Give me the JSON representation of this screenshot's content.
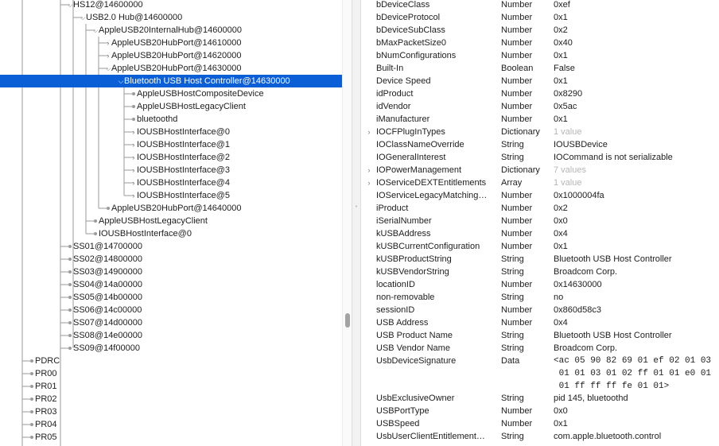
{
  "tree": [
    {
      "label": "HS12@14600000",
      "depth": 3,
      "disclosure": "open"
    },
    {
      "label": "USB2.0 Hub@14600000",
      "depth": 4,
      "disclosure": "open"
    },
    {
      "label": "AppleUSB20InternalHub@14600000",
      "depth": 5,
      "disclosure": "open"
    },
    {
      "label": "AppleUSB20HubPort@14610000",
      "depth": 6,
      "disclosure": "closed"
    },
    {
      "label": "AppleUSB20HubPort@14620000",
      "depth": 6,
      "disclosure": "closed"
    },
    {
      "label": "AppleUSB20HubPort@14630000",
      "depth": 6,
      "disclosure": "open"
    },
    {
      "label": "Bluetooth USB Host Controller@14630000",
      "depth": 7,
      "disclosure": "open",
      "selected": true
    },
    {
      "label": "AppleUSBHostCompositeDevice",
      "depth": 8,
      "disclosure": "leaf"
    },
    {
      "label": "AppleUSBHostLegacyClient",
      "depth": 8,
      "disclosure": "leaf"
    },
    {
      "label": "bluetoothd",
      "depth": 8,
      "disclosure": "leaf"
    },
    {
      "label": "IOUSBHostInterface@0",
      "depth": 8,
      "disclosure": "closed"
    },
    {
      "label": "IOUSBHostInterface@1",
      "depth": 8,
      "disclosure": "closed"
    },
    {
      "label": "IOUSBHostInterface@2",
      "depth": 8,
      "disclosure": "closed"
    },
    {
      "label": "IOUSBHostInterface@3",
      "depth": 8,
      "disclosure": "closed"
    },
    {
      "label": "IOUSBHostInterface@4",
      "depth": 8,
      "disclosure": "closed"
    },
    {
      "label": "IOUSBHostInterface@5",
      "depth": 8,
      "disclosure": "closed"
    },
    {
      "label": "AppleUSB20HubPort@14640000",
      "depth": 6,
      "disclosure": "leaf"
    },
    {
      "label": "AppleUSBHostLegacyClient",
      "depth": 5,
      "disclosure": "leaf"
    },
    {
      "label": "IOUSBHostInterface@0",
      "depth": 5,
      "disclosure": "leaf"
    },
    {
      "label": "SS01@14700000",
      "depth": 3,
      "disclosure": "leaf"
    },
    {
      "label": "SS02@14800000",
      "depth": 3,
      "disclosure": "leaf"
    },
    {
      "label": "SS03@14900000",
      "depth": 3,
      "disclosure": "leaf"
    },
    {
      "label": "SS04@14a00000",
      "depth": 3,
      "disclosure": "leaf"
    },
    {
      "label": "SS05@14b00000",
      "depth": 3,
      "disclosure": "leaf"
    },
    {
      "label": "SS06@14c00000",
      "depth": 3,
      "disclosure": "leaf"
    },
    {
      "label": "SS07@14d00000",
      "depth": 3,
      "disclosure": "leaf"
    },
    {
      "label": "SS08@14e00000",
      "depth": 3,
      "disclosure": "leaf"
    },
    {
      "label": "SS09@14f00000",
      "depth": 3,
      "disclosure": "leaf"
    },
    {
      "label": "PDRC",
      "depth": 1,
      "disclosure": "leaf"
    },
    {
      "label": "PR00",
      "depth": 1,
      "disclosure": "leaf"
    },
    {
      "label": "PR01",
      "depth": 1,
      "disclosure": "leaf"
    },
    {
      "label": "PR02",
      "depth": 1,
      "disclosure": "leaf"
    },
    {
      "label": "PR03",
      "depth": 1,
      "disclosure": "leaf"
    },
    {
      "label": "PR04",
      "depth": 1,
      "disclosure": "leaf"
    },
    {
      "label": "PR05",
      "depth": 1,
      "disclosure": "leaf"
    }
  ],
  "properties": [
    {
      "key": "bDeviceClass",
      "type": "Number",
      "value": "0xef"
    },
    {
      "key": "bDeviceProtocol",
      "type": "Number",
      "value": "0x1"
    },
    {
      "key": "bDeviceSubClass",
      "type": "Number",
      "value": "0x2"
    },
    {
      "key": "bMaxPacketSize0",
      "type": "Number",
      "value": "0x40"
    },
    {
      "key": "bNumConfigurations",
      "type": "Number",
      "value": "0x1"
    },
    {
      "key": "Built-In",
      "type": "Boolean",
      "value": "False"
    },
    {
      "key": "Device Speed",
      "type": "Number",
      "value": "0x1"
    },
    {
      "key": "idProduct",
      "type": "Number",
      "value": "0x8290"
    },
    {
      "key": "idVendor",
      "type": "Number",
      "value": "0x5ac"
    },
    {
      "key": "iManufacturer",
      "type": "Number",
      "value": "0x1"
    },
    {
      "key": "IOCFPlugInTypes",
      "type": "Dictionary",
      "value": "1 value",
      "expandable": true,
      "muted": true
    },
    {
      "key": "IOClassNameOverride",
      "type": "String",
      "value": "IOUSBDevice"
    },
    {
      "key": "IOGeneralInterest",
      "type": "String",
      "value": "IOCommand is not serializable"
    },
    {
      "key": "IOPowerManagement",
      "type": "Dictionary",
      "value": "7 values",
      "expandable": true,
      "muted": true
    },
    {
      "key": "IOServiceDEXTEntitlements",
      "type": "Array",
      "value": "1 value",
      "expandable": true,
      "muted": true
    },
    {
      "key": "IOServiceLegacyMatching…",
      "type": "Number",
      "value": "0x1000004fa"
    },
    {
      "key": "iProduct",
      "type": "Number",
      "value": "0x2"
    },
    {
      "key": "iSerialNumber",
      "type": "Number",
      "value": "0x0"
    },
    {
      "key": "kUSBAddress",
      "type": "Number",
      "value": "0x4"
    },
    {
      "key": "kUSBCurrentConfiguration",
      "type": "Number",
      "value": "0x1"
    },
    {
      "key": "kUSBProductString",
      "type": "String",
      "value": "Bluetooth USB Host Controller"
    },
    {
      "key": "kUSBVendorString",
      "type": "String",
      "value": "Broadcom Corp."
    },
    {
      "key": "locationID",
      "type": "Number",
      "value": "0x14630000"
    },
    {
      "key": "non-removable",
      "type": "String",
      "value": "no"
    },
    {
      "key": "sessionID",
      "type": "Number",
      "value": "0x860d58c3"
    },
    {
      "key": "USB Address",
      "type": "Number",
      "value": "0x4"
    },
    {
      "key": "USB Product Name",
      "type": "String",
      "value": "Bluetooth USB Host Controller"
    },
    {
      "key": "USB Vendor Name",
      "type": "String",
      "value": "Broadcom Corp."
    },
    {
      "key": "UsbDeviceSignature",
      "type": "Data",
      "value": "<ac 05 90 82 69 01 ef 02 01 03\n 01 01 03 01 02 ff 01 01 e0 01\n 01 ff ff ff fe 01 01>",
      "tall": true
    },
    {
      "key": "UsbExclusiveOwner",
      "type": "String",
      "value": "pid 145, bluetoothd"
    },
    {
      "key": "USBPortType",
      "type": "Number",
      "value": "0x0"
    },
    {
      "key": "USBSpeed",
      "type": "Number",
      "value": "0x1"
    },
    {
      "key": "UsbUserClientEntitlement…",
      "type": "String",
      "value": "com.apple.bluetooth.control"
    }
  ],
  "colors": {
    "selection": "#0a5fd6",
    "tree_line": "#9a9a9a",
    "muted": "#b5b5b5"
  }
}
